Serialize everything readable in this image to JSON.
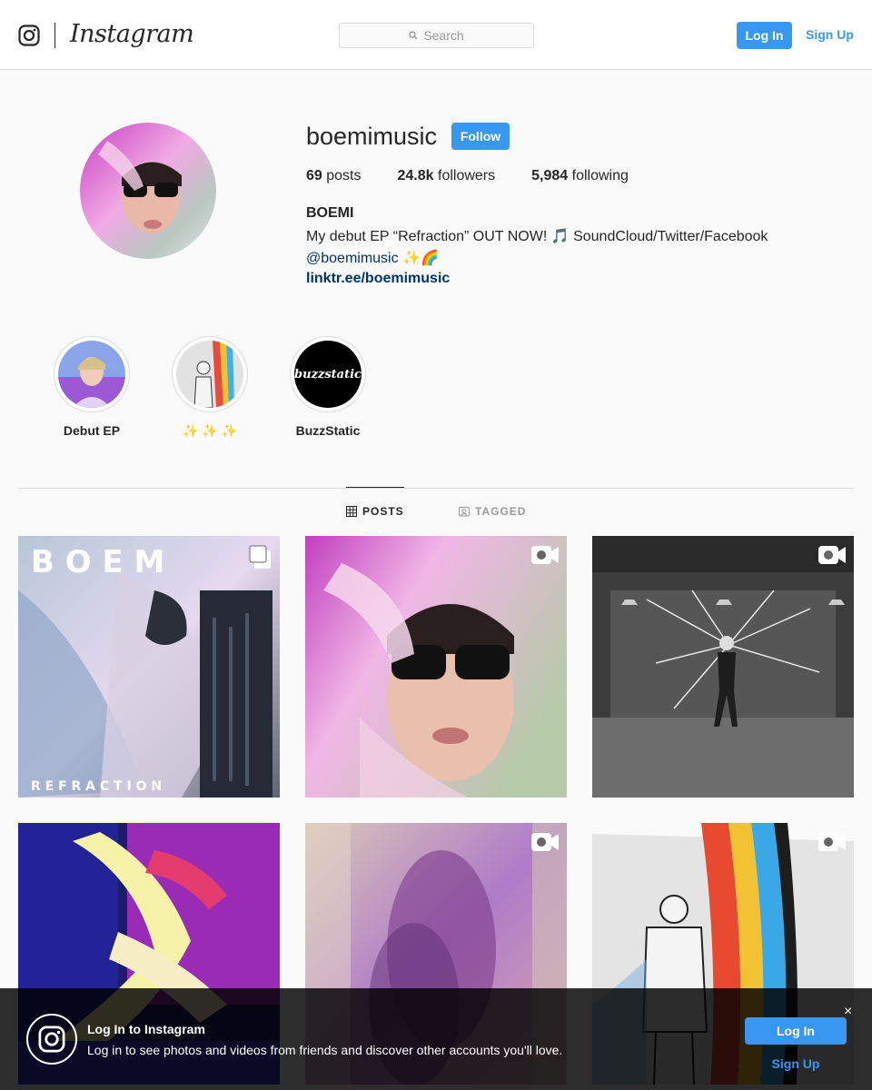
{
  "header": {
    "brand": "Instagram",
    "search_placeholder": "Search",
    "login_label": "Log In",
    "signup_label": "Sign Up"
  },
  "profile": {
    "username": "boemimusic",
    "follow_label": "Follow",
    "posts_count": "69",
    "posts_label": "posts",
    "followers_count": "24.8k",
    "followers_label": "followers",
    "following_count": "5,984",
    "following_label": "following",
    "full_name": "BOEMI",
    "bio_line1": "My debut EP “Refraction” OUT NOW! 🎵 SoundCloud/Twitter/Facebook",
    "bio_mention": "@boemimusic",
    "bio_emoji": "✨🌈",
    "website": "linktr.ee/boemimusic"
  },
  "highlights": [
    {
      "label": "Debut EP"
    },
    {
      "label": "✨ ✨ ✨"
    },
    {
      "label": "BuzzStatic",
      "image_text": "buzzstatic"
    }
  ],
  "tabs": [
    {
      "label": "POSTS",
      "icon": "grid-icon",
      "active": true
    },
    {
      "label": "TAGGED",
      "icon": "tag-icon",
      "active": false
    }
  ],
  "posts": [
    {
      "type": "multiple",
      "overlay_top": "B O E M",
      "overlay_bottom": "R E F R A C T I O N"
    },
    {
      "type": "video"
    },
    {
      "type": "video"
    },
    {
      "type": "image"
    },
    {
      "type": "video"
    },
    {
      "type": "video"
    }
  ],
  "banner": {
    "title": "Log In to Instagram",
    "text": "Log in to see photos and videos from friends and discover other accounts you'll love.",
    "close_glyph": "×",
    "login_label": "Log In",
    "signup_label": "Sign Up"
  },
  "colors": {
    "accent": "#3897f0",
    "link_dark": "#003569",
    "text": "#262626",
    "border": "#dbdbdb"
  }
}
